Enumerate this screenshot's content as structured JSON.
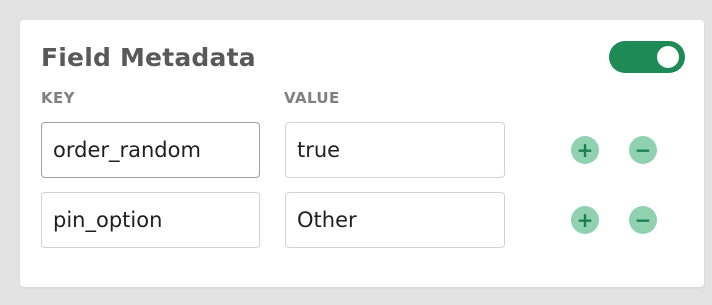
{
  "panel": {
    "title": "Field Metadata",
    "enabled": true
  },
  "columns": {
    "key": "KEY",
    "value": "VALUE"
  },
  "rows": [
    {
      "key": "order_random",
      "value": "true"
    },
    {
      "key": "pin_option",
      "value": "Other"
    }
  ],
  "icons": {
    "add": "+",
    "remove": "−"
  },
  "colors": {
    "accent": "#1e8a56",
    "icon_bg": "#8fd1b1",
    "background": "#e3e3e3"
  }
}
